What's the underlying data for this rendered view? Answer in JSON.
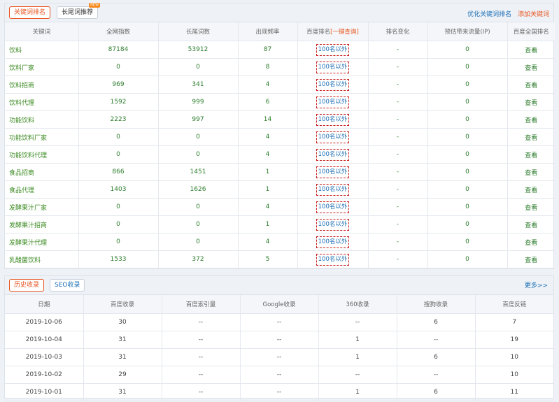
{
  "keywords_panel": {
    "tabs": [
      "关键词排名",
      "长尾词推荐"
    ],
    "new_badge": "NEW",
    "links": {
      "optimize": "优化关键词排名",
      "add": "添加关键词"
    },
    "columns": [
      "关键词",
      "全网指数",
      "长尾词数",
      "出现频率",
      "百度排名",
      "一键查询",
      "排名变化",
      "预估带来流量(IP)",
      "百度全国排名"
    ],
    "rows": [
      {
        "keyword": "饮料",
        "index": "87184",
        "longtail": "53912",
        "freq": "87",
        "rank": "100名以外",
        "change": "-",
        "traffic": "0",
        "view": "查看"
      },
      {
        "keyword": "饮料厂家",
        "index": "0",
        "longtail": "0",
        "freq": "8",
        "rank": "100名以外",
        "change": "-",
        "traffic": "0",
        "view": "查看"
      },
      {
        "keyword": "饮料招商",
        "index": "969",
        "longtail": "341",
        "freq": "4",
        "rank": "100名以外",
        "change": "-",
        "traffic": "0",
        "view": "查看"
      },
      {
        "keyword": "饮料代理",
        "index": "1592",
        "longtail": "999",
        "freq": "6",
        "rank": "100名以外",
        "change": "-",
        "traffic": "0",
        "view": "查看"
      },
      {
        "keyword": "功能饮料",
        "index": "2223",
        "longtail": "997",
        "freq": "14",
        "rank": "100名以外",
        "change": "-",
        "traffic": "0",
        "view": "查看"
      },
      {
        "keyword": "功能饮料厂家",
        "index": "0",
        "longtail": "0",
        "freq": "4",
        "rank": "100名以外",
        "change": "-",
        "traffic": "0",
        "view": "查看"
      },
      {
        "keyword": "功能饮料代理",
        "index": "0",
        "longtail": "0",
        "freq": "4",
        "rank": "100名以外",
        "change": "-",
        "traffic": "0",
        "view": "查看"
      },
      {
        "keyword": "食品招商",
        "index": "866",
        "longtail": "1451",
        "freq": "1",
        "rank": "100名以外",
        "change": "-",
        "traffic": "0",
        "view": "查看"
      },
      {
        "keyword": "食品代理",
        "index": "1403",
        "longtail": "1626",
        "freq": "1",
        "rank": "100名以外",
        "change": "-",
        "traffic": "0",
        "view": "查看"
      },
      {
        "keyword": "发酵果汁厂家",
        "index": "0",
        "longtail": "0",
        "freq": "4",
        "rank": "100名以外",
        "change": "-",
        "traffic": "0",
        "view": "查看"
      },
      {
        "keyword": "发酵果汁招商",
        "index": "0",
        "longtail": "0",
        "freq": "1",
        "rank": "100名以外",
        "change": "-",
        "traffic": "0",
        "view": "查看"
      },
      {
        "keyword": "发酵果汁代理",
        "index": "0",
        "longtail": "0",
        "freq": "4",
        "rank": "100名以外",
        "change": "-",
        "traffic": "0",
        "view": "查看"
      },
      {
        "keyword": "乳酸菌饮料",
        "index": "1533",
        "longtail": "372",
        "freq": "5",
        "rank": "100名以外",
        "change": "-",
        "traffic": "0",
        "view": "查看"
      }
    ]
  },
  "history_panel": {
    "tabs": [
      "历史收录",
      "SEO收录"
    ],
    "more": "更多>>",
    "columns": [
      "日期",
      "百度收录",
      "百度索引量",
      "Google收录",
      "360收录",
      "搜狗收录",
      "百度反链"
    ],
    "rows": [
      [
        "2019-10-06",
        "30",
        "--",
        "--",
        "--",
        "6",
        "7"
      ],
      [
        "2019-10-04",
        "31",
        "--",
        "--",
        "1",
        "--",
        "19"
      ],
      [
        "2019-10-03",
        "31",
        "--",
        "--",
        "1",
        "6",
        "10"
      ],
      [
        "2019-10-02",
        "29",
        "--",
        "--",
        "--",
        "--",
        "10"
      ],
      [
        "2019-10-01",
        "31",
        "--",
        "--",
        "1",
        "6",
        "11"
      ]
    ]
  },
  "colors": {
    "accent_orange": "#e8541e",
    "link_blue": "#1e6fb5",
    "value_green": "#2e7d2e"
  }
}
